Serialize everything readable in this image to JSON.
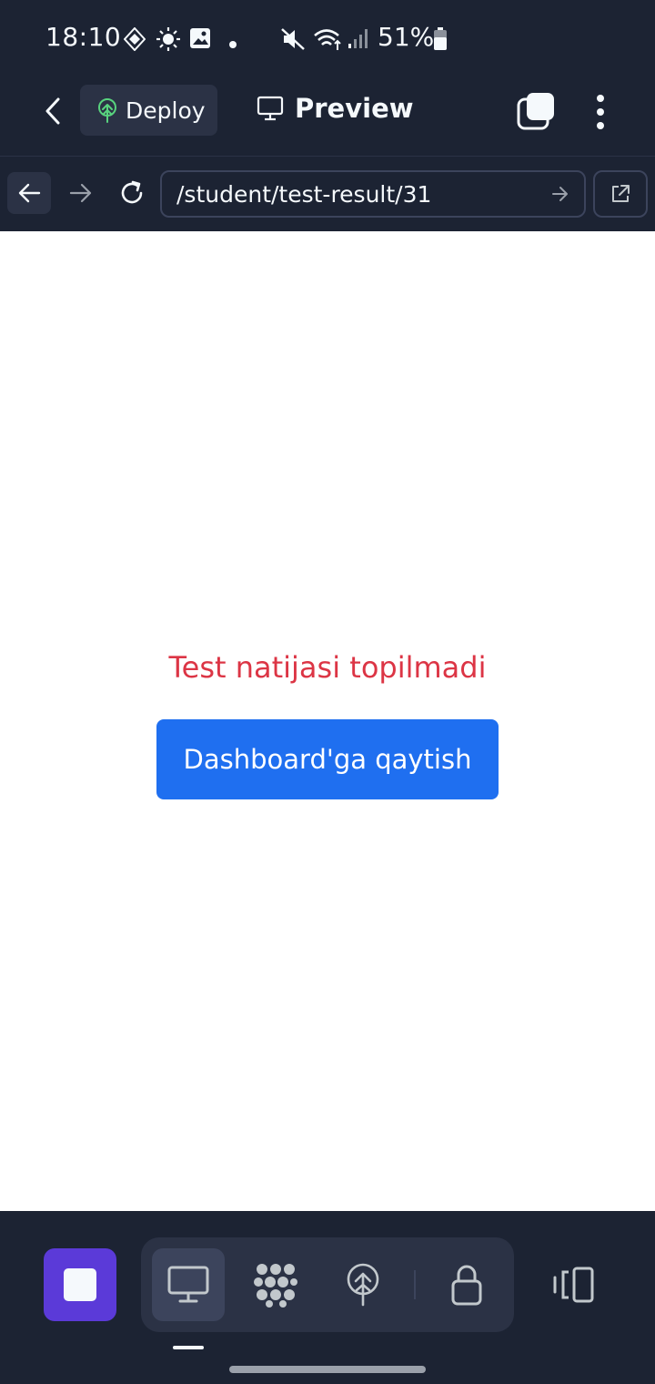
{
  "status_bar": {
    "time": "18:10",
    "battery_text": "51%",
    "icons": [
      "signal-diamond-icon",
      "brightness-icon",
      "image-icon",
      "dot-icon",
      "mute-icon",
      "wifi-icon",
      "cell-signal-icon",
      "battery-icon"
    ]
  },
  "app_bar": {
    "deploy_label": "Deploy",
    "title": "Preview",
    "icons": [
      "back-chevron-icon",
      "deploy-tree-icon",
      "monitor-icon",
      "tabs-icon",
      "more-vertical-icon"
    ]
  },
  "browser_nav": {
    "url": "/student/test-result/31",
    "icons": [
      "arrow-left-icon",
      "arrow-right-icon",
      "reload-icon",
      "go-arrow-icon",
      "external-link-icon"
    ]
  },
  "page": {
    "error_message": "Test natijasi topilmadi",
    "button_label": "Dashboard'ga qaytish"
  },
  "bottom_toolbar": {
    "tools": [
      "preview-tool",
      "packages-tool",
      "deploy-tool",
      "secrets-tool"
    ],
    "active_tool": "preview-tool"
  },
  "colors": {
    "app_background": "#1c2333",
    "surface": "#2b3245",
    "error_text": "#dc3545",
    "primary_button": "#1f6ff0",
    "stop_button": "#5b3ad8",
    "deploy_icon": "#58d37e"
  }
}
